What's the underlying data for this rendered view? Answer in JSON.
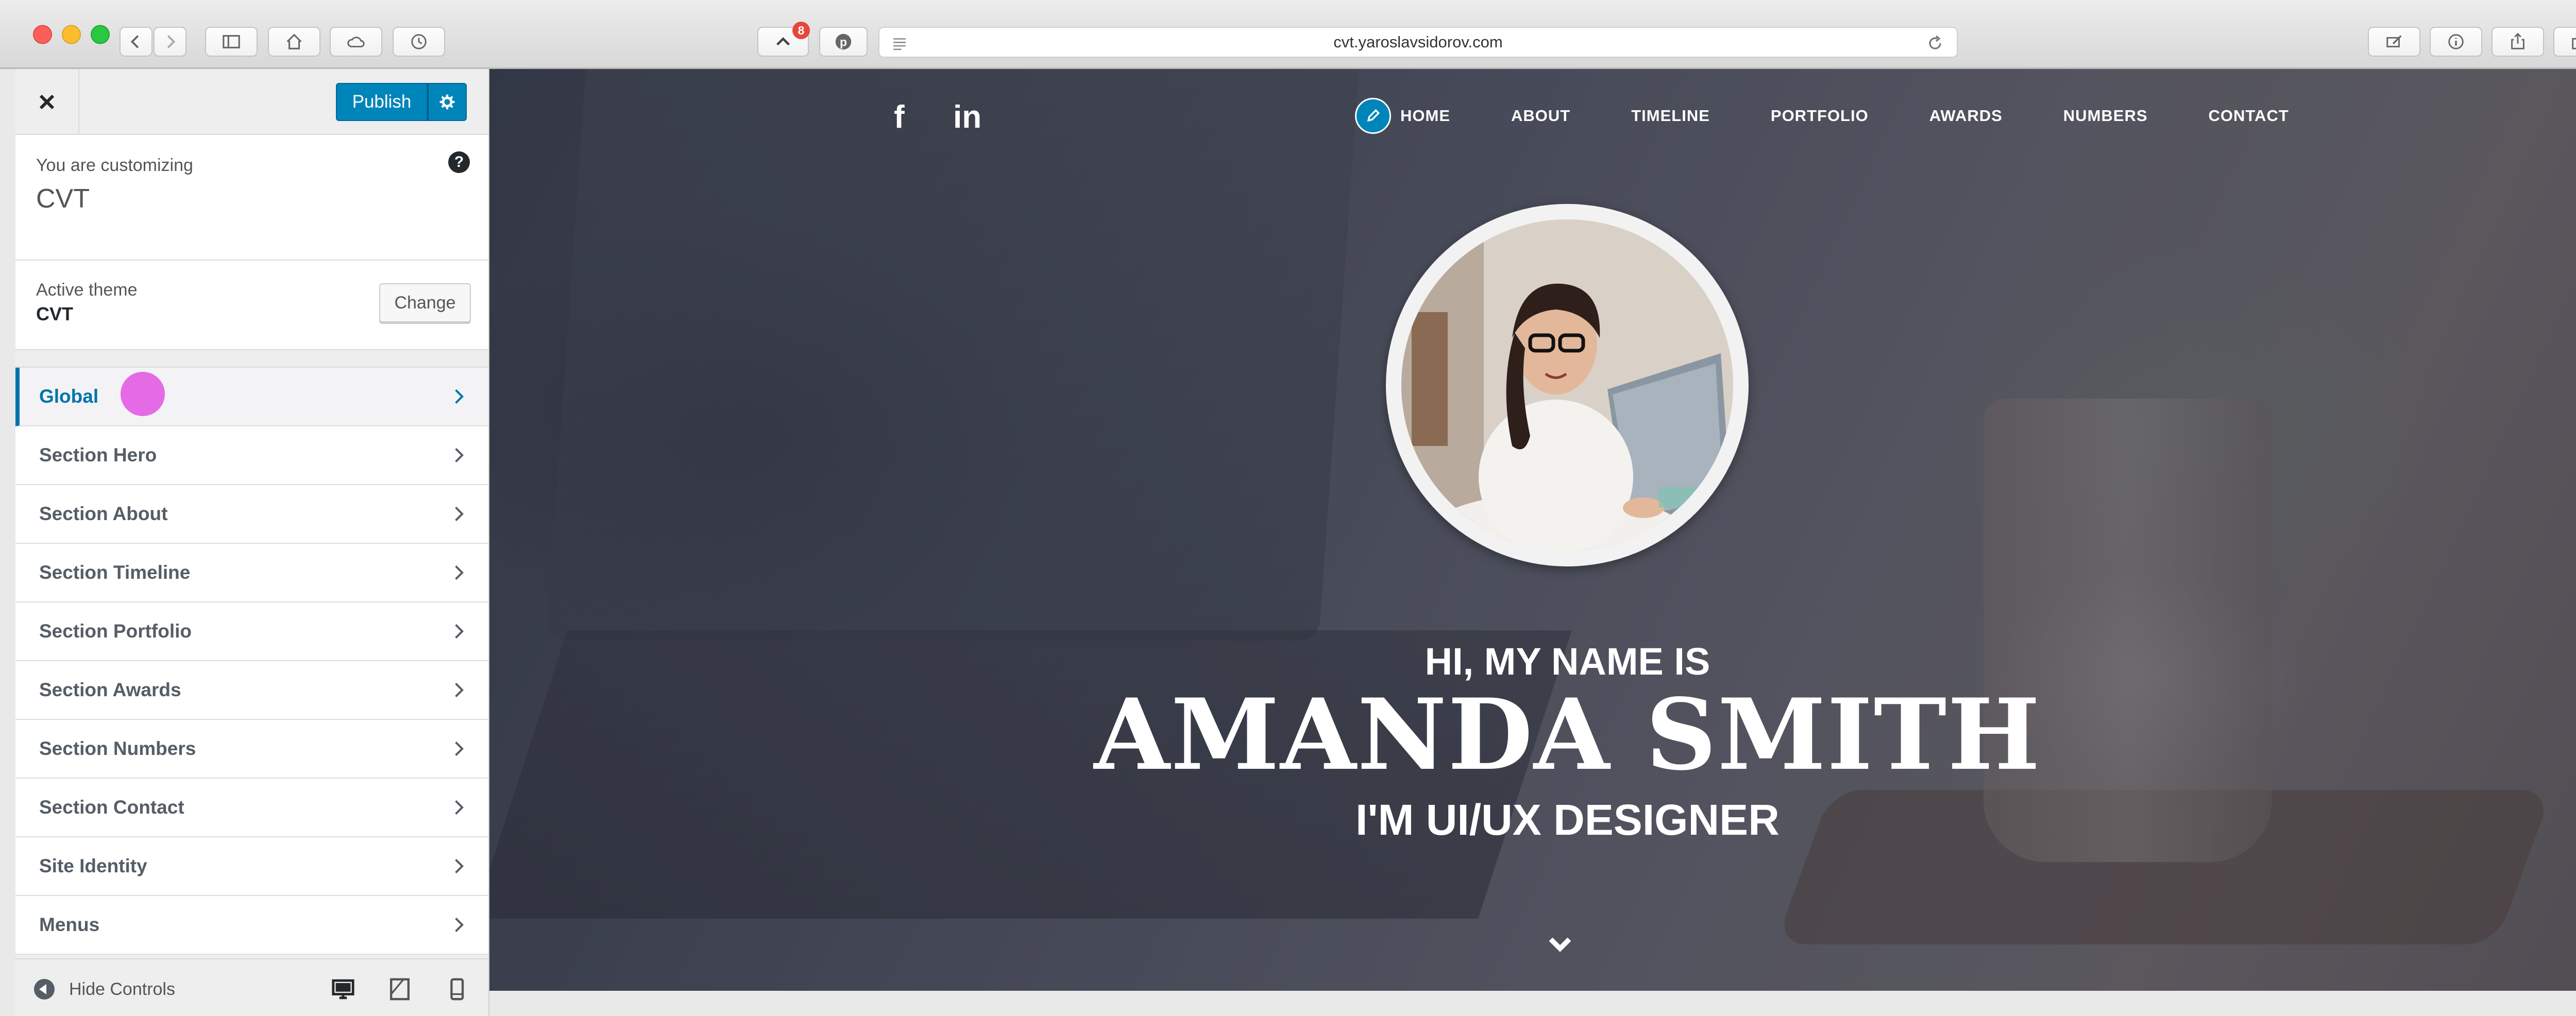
{
  "browser": {
    "url": "cvt.yaroslavsidorov.com",
    "notification_count": "8"
  },
  "customizer": {
    "publish_label": "Publish",
    "customizing_label": "You are customizing",
    "site_title": "CVT",
    "active_theme_label": "Active theme",
    "active_theme_name": "CVT",
    "change_label": "Change",
    "sections": [
      {
        "label": "Global",
        "active": true
      },
      {
        "label": "Section Hero"
      },
      {
        "label": "Section About"
      },
      {
        "label": "Section Timeline"
      },
      {
        "label": "Section Portfolio"
      },
      {
        "label": "Section Awards"
      },
      {
        "label": "Section Numbers"
      },
      {
        "label": "Section Contact"
      },
      {
        "label": "Site Identity"
      },
      {
        "label": "Menus"
      }
    ],
    "hide_controls_label": "Hide Controls",
    "accent_color": "#0073aa"
  },
  "preview": {
    "social": [
      "f",
      "in"
    ],
    "nav": [
      "HOME",
      "ABOUT",
      "TIMELINE",
      "PORTFOLIO",
      "AWARDS",
      "NUMBERS",
      "CONTACT"
    ],
    "greeting": "HI, MY NAME IS",
    "name": "AMANDA SMITH",
    "role": "I'M UI/UX DESIGNER"
  }
}
